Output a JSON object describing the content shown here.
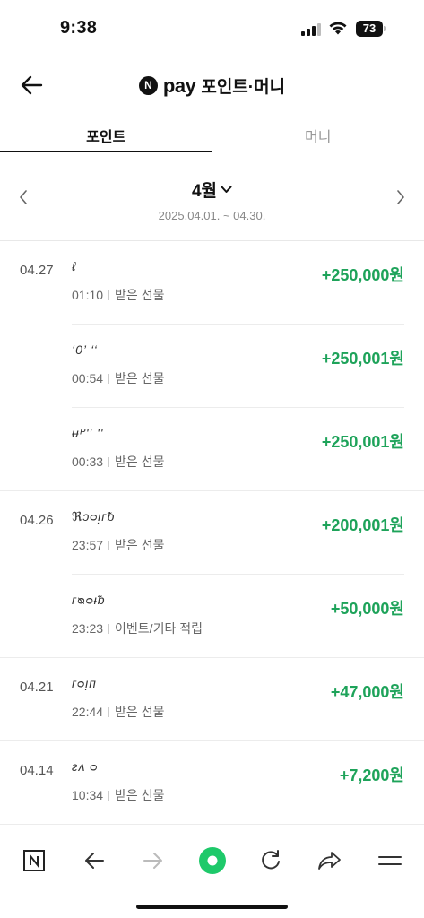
{
  "status": {
    "time": "9:38",
    "battery": "73"
  },
  "header": {
    "logo_letter": "N",
    "brand": "pay",
    "title": "포인트·머니"
  },
  "tabs": [
    {
      "label": "포인트",
      "active": true
    },
    {
      "label": "머니",
      "active": false
    }
  ],
  "month": {
    "label": "4월",
    "range": "2025.04.01. ~ 04.30."
  },
  "transactions": [
    {
      "date": "04.27",
      "name": "ℓ",
      "time": "01:10",
      "type": "받은 선물",
      "amount": "+250,000원"
    },
    {
      "date": "",
      "name": "‘0’  ‘‘",
      "time": "00:54",
      "type": "받은 선물",
      "amount": "+250,001원"
    },
    {
      "date": "",
      "name": "ᵾᴾ''  ''",
      "time": "00:33",
      "type": "받은 선물",
      "amount": "+250,001원"
    },
    {
      "date": "04.26",
      "name": "ℜᴐᴑᴉᴦᵬ",
      "time": "23:57",
      "type": "받은 선물",
      "amount": "+200,001원"
    },
    {
      "date": "",
      "name": "ᴦᴓᴑᵼᵬ",
      "time": "23:23",
      "type": "이벤트/기타 적립",
      "amount": "+50,000원"
    },
    {
      "date": "04.21",
      "name": "ᴦᴑᴉᴨ",
      "time": "22:44",
      "type": "받은 선물",
      "amount": "+47,000원"
    },
    {
      "date": "04.14",
      "name": "ᴤᴧ ᴑ",
      "time": "10:34",
      "type": "받은 선물",
      "amount": "+7,200원"
    }
  ],
  "colors": {
    "accent_green": "#1ea35a",
    "home_dot": "#1ec96a"
  },
  "bottom_nav": [
    {
      "icon": "naver-n-icon"
    },
    {
      "icon": "back-arrow-icon"
    },
    {
      "icon": "forward-arrow-icon"
    },
    {
      "icon": "home-dot-icon"
    },
    {
      "icon": "refresh-icon"
    },
    {
      "icon": "share-icon"
    },
    {
      "icon": "menu-icon"
    }
  ]
}
